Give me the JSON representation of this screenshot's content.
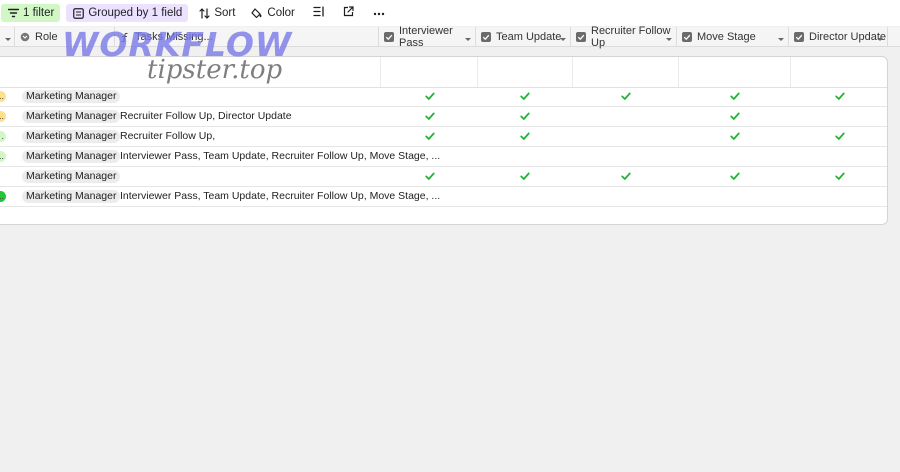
{
  "toolbar": {
    "filter_label": "1 filter",
    "group_label": "Grouped by 1 field",
    "sort_label": "Sort",
    "color_label": "Color"
  },
  "columns": [
    {
      "label": "Role"
    },
    {
      "label": "Tasks Missing..."
    },
    {
      "label": "Interviewer Pass"
    },
    {
      "label": "Team Update"
    },
    {
      "label": "Recruiter Follow Up"
    },
    {
      "label": "Move Stage"
    },
    {
      "label": "Director Update"
    }
  ],
  "rows": [
    {
      "stage": "...",
      "stage_color": "#ffe08a",
      "role": "Marketing Manager",
      "tasks": "",
      "checks": [
        true,
        true,
        true,
        true,
        true
      ]
    },
    {
      "stage": "...",
      "stage_color": "#ffe08a",
      "role": "Marketing Manager",
      "tasks": "Recruiter Follow Up, Director Update",
      "checks": [
        true,
        true,
        false,
        true,
        false
      ]
    },
    {
      "stage": ".",
      "stage_color": "#d1f7c4",
      "role": "Marketing Manager",
      "tasks": "Recruiter Follow Up,",
      "checks": [
        true,
        true,
        false,
        true,
        true
      ]
    },
    {
      "stage": "...",
      "stage_color": "#d1f7c4",
      "role": "Marketing Manager",
      "tasks": "Interviewer Pass, Team Update, Recruiter Follow Up, Move Stage, ...",
      "checks": [
        false,
        false,
        false,
        false,
        false
      ]
    },
    {
      "stage": "",
      "stage_color": "#ffffff",
      "role": "Marketing Manager",
      "tasks": "",
      "checks": [
        true,
        true,
        true,
        true,
        true
      ]
    },
    {
      "stage": "...",
      "stage_color": "#20c933",
      "role": "Marketing Manager",
      "tasks": "Interviewer Pass, Team Update, Recruiter Follow Up, Move Stage, ...",
      "checks": [
        false,
        false,
        false,
        false,
        false
      ]
    }
  ],
  "watermark": {
    "line1": "WORKFLOW",
    "line2": "tipster.top"
  },
  "colors": {
    "check": "#20b634",
    "filter_bg": "#d1f7c4",
    "group_bg": "#ede2fe"
  }
}
